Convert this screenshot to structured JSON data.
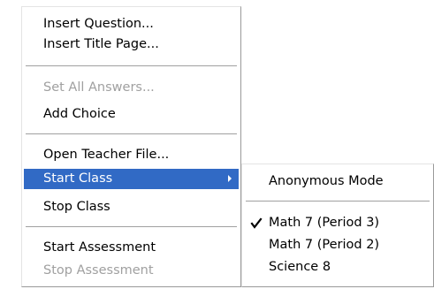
{
  "main_menu": {
    "items": [
      {
        "label": "Insert Question..."
      },
      {
        "label": "Insert Title Page..."
      },
      {
        "label": "Set All Answers..."
      },
      {
        "label": "Add Choice"
      },
      {
        "label": "Open Teacher File..."
      },
      {
        "label": "Start Class"
      },
      {
        "label": "Stop Class"
      },
      {
        "label": "Start Assessment"
      },
      {
        "label": "Stop Assessment"
      }
    ]
  },
  "sub_menu": {
    "items": [
      {
        "label": "Anonymous Mode"
      },
      {
        "label": "Math 7 (Period 3)",
        "checked": true
      },
      {
        "label": "Math 7 (Period 2)"
      },
      {
        "label": "Science 8"
      }
    ]
  },
  "colors": {
    "selection": "#316ac5",
    "disabled_text": "#a0a0a0"
  },
  "icons": {
    "submenu_arrow": "chevron-right-icon",
    "checked_mark": "check-icon"
  }
}
